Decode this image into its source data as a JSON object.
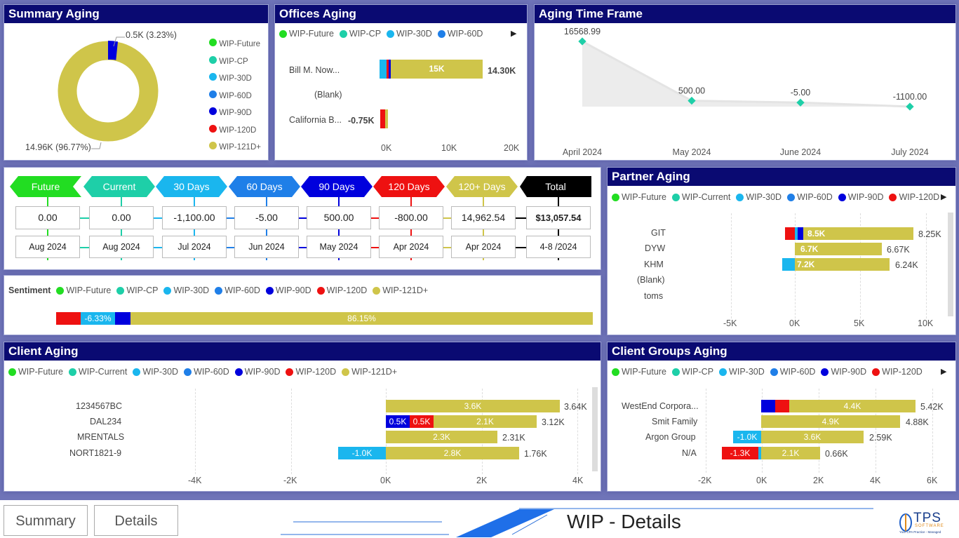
{
  "colors": {
    "future": "#22dd22",
    "cp": "#1ecfa8",
    "d30": "#1ab6ee",
    "d60": "#1f7fe8",
    "d90": "#0000dd",
    "d120": "#ee1111",
    "d121": "#cfc54a",
    "header": "#0a0a72",
    "total": "#000000"
  },
  "legend_full": [
    "WIP-Future",
    "WIP-CP",
    "WIP-30D",
    "WIP-60D",
    "WIP-90D",
    "WIP-120D",
    "WIP-121D+"
  ],
  "legend_current": [
    "WIP-Future",
    "WIP-Current",
    "WIP-30D",
    "WIP-60D",
    "WIP-90D",
    "WIP-120D",
    "WIP-121D+"
  ],
  "summary": {
    "title": "Summary Aging",
    "label_small": "0.5K (3.23%)",
    "label_large": "14.96K (96.77%)"
  },
  "offices": {
    "title": "Offices Aging",
    "legend": [
      "WIP-Future",
      "WIP-CP",
      "WIP-30D",
      "WIP-60D"
    ],
    "rows": [
      {
        "name": "Bill M. Now...",
        "inner": "15K",
        "total": "14.30K"
      },
      {
        "name": "(Blank)",
        "inner": "",
        "total": ""
      },
      {
        "name": "California B...",
        "inner": "",
        "neg": "-0.75K"
      }
    ],
    "axis": [
      "0K",
      "10K",
      "20K"
    ]
  },
  "timeframe": {
    "title": "Aging Time Frame",
    "x": [
      "April 2024",
      "May 2024",
      "June 2024",
      "July 2024"
    ],
    "y": [
      16568.99,
      500,
      -5,
      -1100
    ],
    "labels": [
      "16568.99",
      "500.00",
      "-5.00",
      "-1100.00"
    ]
  },
  "buckets": {
    "heads": [
      "Future",
      "Current",
      "30 Days",
      "60 Days",
      "90 Days",
      "120 Days",
      "120+ Days",
      "Total"
    ],
    "values": [
      "0.00",
      "0.00",
      "-1,100.00",
      "-5.00",
      "500.00",
      "-800.00",
      "14,962.54",
      "$13,057.54"
    ],
    "dates": [
      "Aug 2024",
      "Aug 2024",
      "Jul 2024",
      "Jun 2024",
      "May 2024",
      "Apr 2024",
      "Apr 2024",
      "4-8 /2024"
    ]
  },
  "sentiment": {
    "title": "Sentiment",
    "pct_30": "-6.33%",
    "pct_121": "86.15%"
  },
  "partner": {
    "title": "Partner Aging",
    "legend": [
      "WIP-Future",
      "WIP-Current",
      "WIP-30D",
      "WIP-60D",
      "WIP-90D",
      "WIP-120D"
    ],
    "rows": [
      {
        "name": "GIT",
        "inner": "8.5K",
        "total": "8.25K"
      },
      {
        "name": "DYW",
        "inner": "6.7K",
        "total": "6.67K"
      },
      {
        "name": "KHM",
        "inner": "7.2K",
        "total": "6.24K"
      },
      {
        "name": "(Blank)",
        "inner": "",
        "total": ""
      },
      {
        "name": "toms",
        "inner": "",
        "total": ""
      }
    ],
    "axis": [
      "-5K",
      "0K",
      "5K",
      "10K"
    ]
  },
  "client": {
    "title": "Client Aging",
    "rows": [
      {
        "name": "1234567BC",
        "inner": "3.6K",
        "total": "3.64K"
      },
      {
        "name": "DAL234",
        "v90": "0.5K",
        "v120": "0.5K",
        "inner": "2.1K",
        "total": "3.12K"
      },
      {
        "name": "MRENTALS",
        "inner": "2.3K",
        "total": "2.31K"
      },
      {
        "name": "NORT1821-9",
        "v30": "-1.0K",
        "inner": "2.8K",
        "total": "1.76K"
      }
    ],
    "axis": [
      "-4K",
      "-2K",
      "0K",
      "2K",
      "4K"
    ]
  },
  "groups": {
    "title": "Client Groups Aging",
    "legend": [
      "WIP-Future",
      "WIP-CP",
      "WIP-30D",
      "WIP-60D",
      "WIP-90D",
      "WIP-120D"
    ],
    "rows": [
      {
        "name": "WestEnd Corpora...",
        "inner": "4.4K",
        "total": "5.42K"
      },
      {
        "name": "Smit Family",
        "inner": "4.9K",
        "total": "4.88K"
      },
      {
        "name": "Argon Group",
        "v30": "-1.0K",
        "inner": "3.6K",
        "total": "2.59K"
      },
      {
        "name": "N/A",
        "v120": "-1.3K",
        "inner": "2.1K",
        "total": "0.66K"
      }
    ],
    "axis": [
      "-2K",
      "0K",
      "2K",
      "4K",
      "6K"
    ]
  },
  "footer": {
    "summary_tab": "Summary",
    "details_tab": "Details",
    "page_title": "WIP - Details",
    "logo_text": "TPS",
    "logo_sub": "SOFTWARE",
    "logo_tag": "Your CPA Practice - Managed"
  }
}
